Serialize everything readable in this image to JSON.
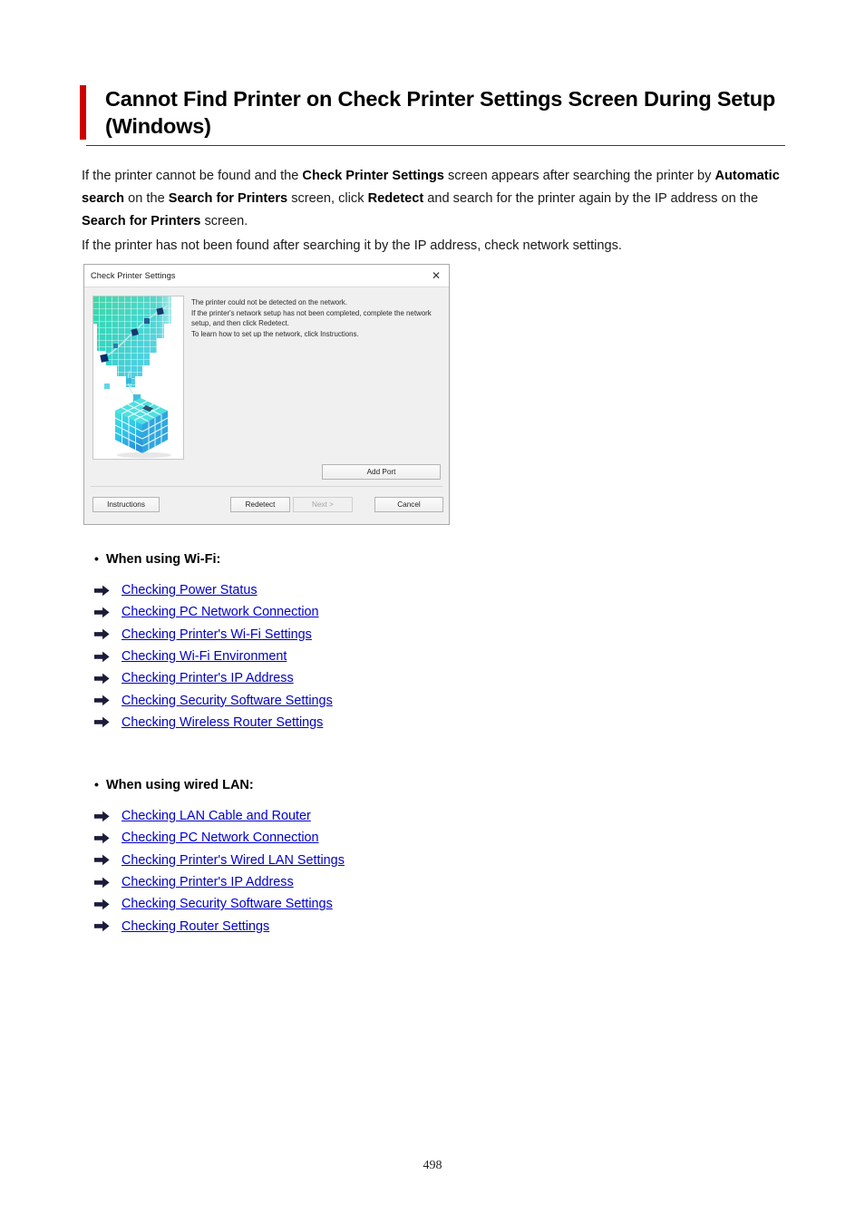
{
  "colors": {
    "accent_red": "#cc0000",
    "link_blue": "#0000cc",
    "arrow_navy": "#1b1b3a",
    "text_black": "#000000"
  },
  "heading": {
    "title": "Cannot Find Printer on Check Printer Settings Screen During Setup (Windows)"
  },
  "body": {
    "paragraph_1_parts": [
      {
        "text": "If the printer cannot be found and the ",
        "bold": false
      },
      {
        "text": "Check Printer Settings",
        "bold": true
      },
      {
        "text": " screen appears after searching the printer by ",
        "bold": false
      },
      {
        "text": "Automatic search",
        "bold": true
      },
      {
        "text": " on the ",
        "bold": false
      },
      {
        "text": "Search for Printers",
        "bold": true
      },
      {
        "text": " screen, click ",
        "bold": false
      },
      {
        "text": "Redetect",
        "bold": true
      },
      {
        "text": " and search for the printer again by the IP address on the ",
        "bold": false
      },
      {
        "text": "Search for Printers",
        "bold": true
      },
      {
        "text": " screen.",
        "bold": false
      }
    ],
    "paragraph_2": "If the printer has not been found after searching it by the IP address, check network settings."
  },
  "dialog": {
    "title": "Check Printer Settings",
    "close_label": "✕",
    "message": "The printer could not be detected on the network.\nIf the printer's network setup has not been completed, complete the network setup, and then click Redetect.\nTo learn how to set up the network, click Instructions.",
    "add_port_label": "Add Port",
    "buttons": [
      {
        "label": "Instructions",
        "disabled": false
      },
      {
        "label": "Redetect",
        "disabled": false
      },
      {
        "label": "Next >",
        "disabled": true
      },
      {
        "label": "Cancel",
        "disabled": false
      }
    ],
    "illustration": "network-printer-cube-graphic"
  },
  "sections": [
    {
      "heading": "When using Wi-Fi:",
      "bullet": "•",
      "links": [
        "Checking Power Status",
        "Checking PC Network Connection",
        "Checking Printer's Wi-Fi Settings",
        "Checking Wi-Fi Environment",
        "Checking Printer's IP Address",
        "Checking Security Software Settings",
        "Checking Wireless Router Settings"
      ]
    },
    {
      "heading": "When using wired LAN:",
      "bullet": "•",
      "links": [
        "Checking LAN Cable and Router",
        "Checking PC Network Connection",
        "Checking Printer's Wired LAN Settings",
        "Checking Printer's IP Address",
        "Checking Security Software Settings",
        "Checking Router Settings"
      ]
    }
  ],
  "footer": {
    "page_number": "498"
  }
}
